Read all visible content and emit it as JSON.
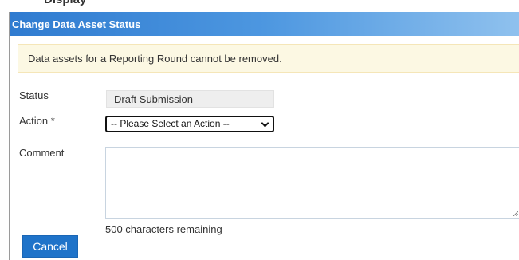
{
  "page": {
    "heading_fragment": "Display"
  },
  "dialog": {
    "title": "Change Data Asset Status",
    "alert": "Data assets for a Reporting Round cannot be removed.",
    "status_label": "Status",
    "status_value": "Draft Submission",
    "action_label": "Action *",
    "action_selected": "-- Please Select an Action --",
    "comment_label": "Comment",
    "comment_value": "",
    "chars_remaining": "500 characters remaining",
    "cancel_label": "Cancel"
  },
  "colors": {
    "header_start": "#2f7bd0",
    "header_end": "#8fc1ee",
    "alert_bg": "#fcf8e3",
    "button_bg": "#1f73c9"
  },
  "icons": {
    "select_arrow": "chevron-down-icon",
    "textarea_resize": "resize-grip-icon"
  }
}
